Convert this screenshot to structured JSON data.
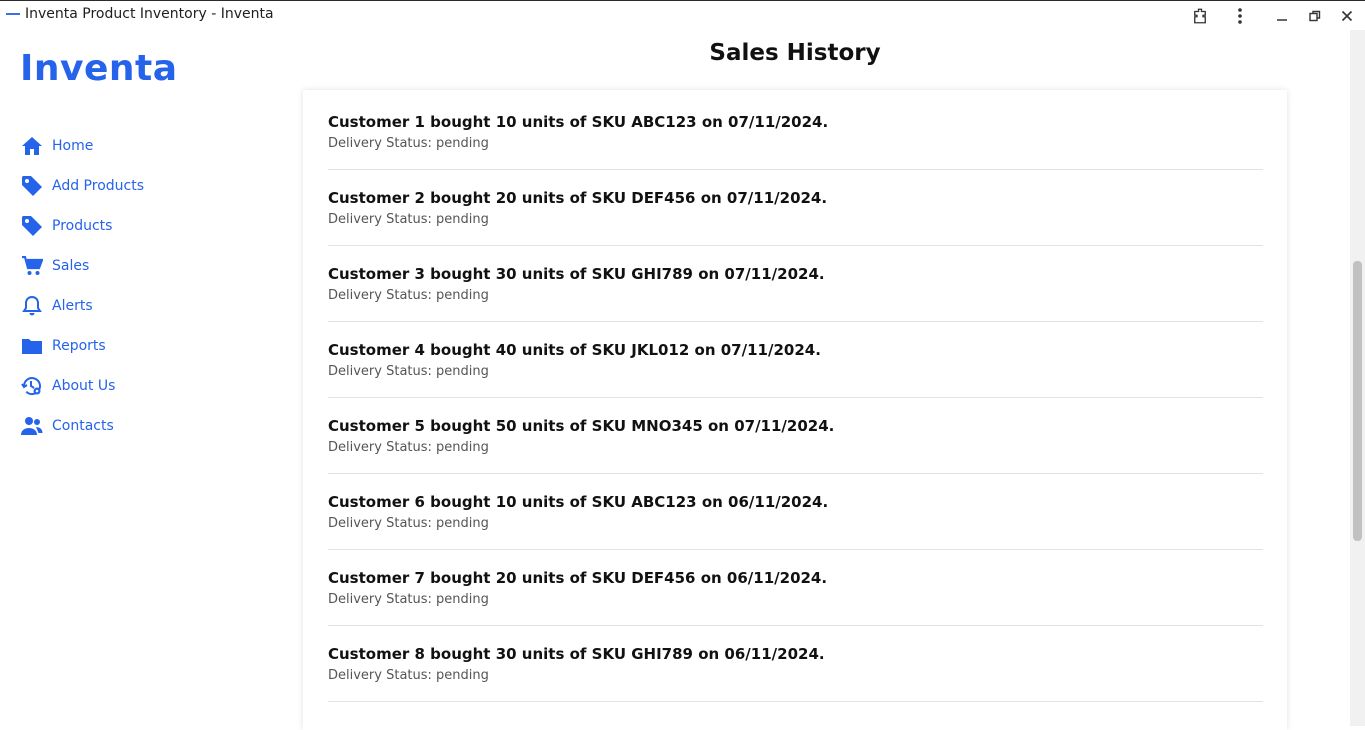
{
  "window": {
    "title": "Inventa Product Inventory - Inventa"
  },
  "brand": "Inventa",
  "nav": [
    {
      "label": "Home",
      "icon": "home-icon"
    },
    {
      "label": "Add Products",
      "icon": "tag-icon"
    },
    {
      "label": "Products",
      "icon": "tag-icon"
    },
    {
      "label": "Sales",
      "icon": "cart-icon"
    },
    {
      "label": "Alerts",
      "icon": "bell-icon"
    },
    {
      "label": "Reports",
      "icon": "folder-icon"
    },
    {
      "label": "About Us",
      "icon": "history-gear-icon"
    },
    {
      "label": "Contacts",
      "icon": "users-icon"
    }
  ],
  "page_title": "Sales History",
  "sales": [
    {
      "text": "Customer 1 bought 10 units of SKU ABC123 on 07/11/2024.",
      "status": "Delivery Status: pending"
    },
    {
      "text": "Customer 2 bought 20 units of SKU DEF456 on 07/11/2024.",
      "status": "Delivery Status: pending"
    },
    {
      "text": "Customer 3 bought 30 units of SKU GHI789 on 07/11/2024.",
      "status": "Delivery Status: pending"
    },
    {
      "text": "Customer 4 bought 40 units of SKU JKL012 on 07/11/2024.",
      "status": "Delivery Status: pending"
    },
    {
      "text": "Customer 5 bought 50 units of SKU MNO345 on 07/11/2024.",
      "status": "Delivery Status: pending"
    },
    {
      "text": "Customer 6 bought 10 units of SKU ABC123 on 06/11/2024.",
      "status": "Delivery Status: pending"
    },
    {
      "text": "Customer 7 bought 20 units of SKU DEF456 on 06/11/2024.",
      "status": "Delivery Status: pending"
    },
    {
      "text": "Customer 8 bought 30 units of SKU GHI789 on 06/11/2024.",
      "status": "Delivery Status: pending"
    }
  ],
  "colors": {
    "accent": "#2563eb",
    "text": "#111111",
    "muted": "#555555"
  }
}
